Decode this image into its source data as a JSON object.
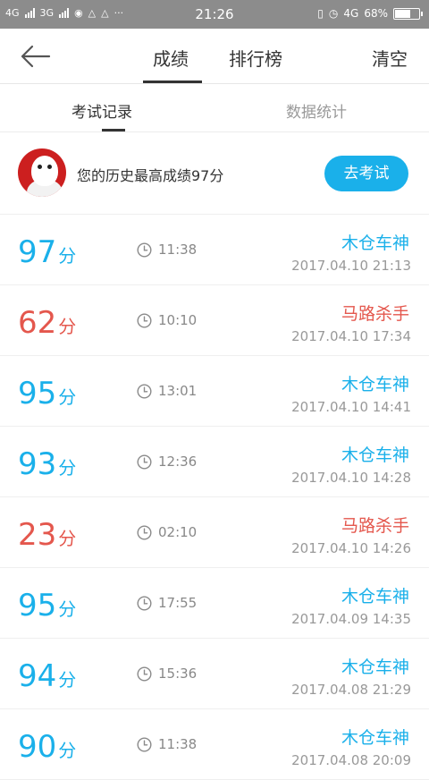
{
  "status_bar": {
    "network_left": "4G",
    "network_mid": "3G",
    "time": "21:26",
    "network_right": "4G",
    "battery": "68%",
    "battery_level": 0.68
  },
  "header": {
    "tabs": [
      {
        "label": "成绩"
      },
      {
        "label": "排行榜"
      }
    ],
    "clear_label": "清空"
  },
  "subtabs": {
    "active": "考试记录",
    "inactive": "数据统计"
  },
  "best": {
    "text": "您的历史最高成绩97分",
    "button": "去考试"
  },
  "records": [
    {
      "score": "97",
      "unit": "分",
      "duration": "11:38",
      "title": "木仓车神",
      "date": "2017.04.10  21:13",
      "color": "blue"
    },
    {
      "score": "62",
      "unit": "分",
      "duration": "10:10",
      "title": "马路杀手",
      "date": "2017.04.10  17:34",
      "color": "red"
    },
    {
      "score": "95",
      "unit": "分",
      "duration": "13:01",
      "title": "木仓车神",
      "date": "2017.04.10  14:41",
      "color": "blue"
    },
    {
      "score": "93",
      "unit": "分",
      "duration": "12:36",
      "title": "木仓车神",
      "date": "2017.04.10  14:28",
      "color": "blue"
    },
    {
      "score": "23",
      "unit": "分",
      "duration": "02:10",
      "title": "马路杀手",
      "date": "2017.04.10  14:26",
      "color": "red"
    },
    {
      "score": "95",
      "unit": "分",
      "duration": "17:55",
      "title": "木仓车神",
      "date": "2017.04.09  14:35",
      "color": "blue"
    },
    {
      "score": "94",
      "unit": "分",
      "duration": "15:36",
      "title": "木仓车神",
      "date": "2017.04.08  21:29",
      "color": "blue"
    },
    {
      "score": "90",
      "unit": "分",
      "duration": "11:38",
      "title": "木仓车神",
      "date": "2017.04.08  20:09",
      "color": "blue"
    }
  ],
  "colors": {
    "accent_blue": "#1ab0ea",
    "accent_red": "#e4574d"
  }
}
